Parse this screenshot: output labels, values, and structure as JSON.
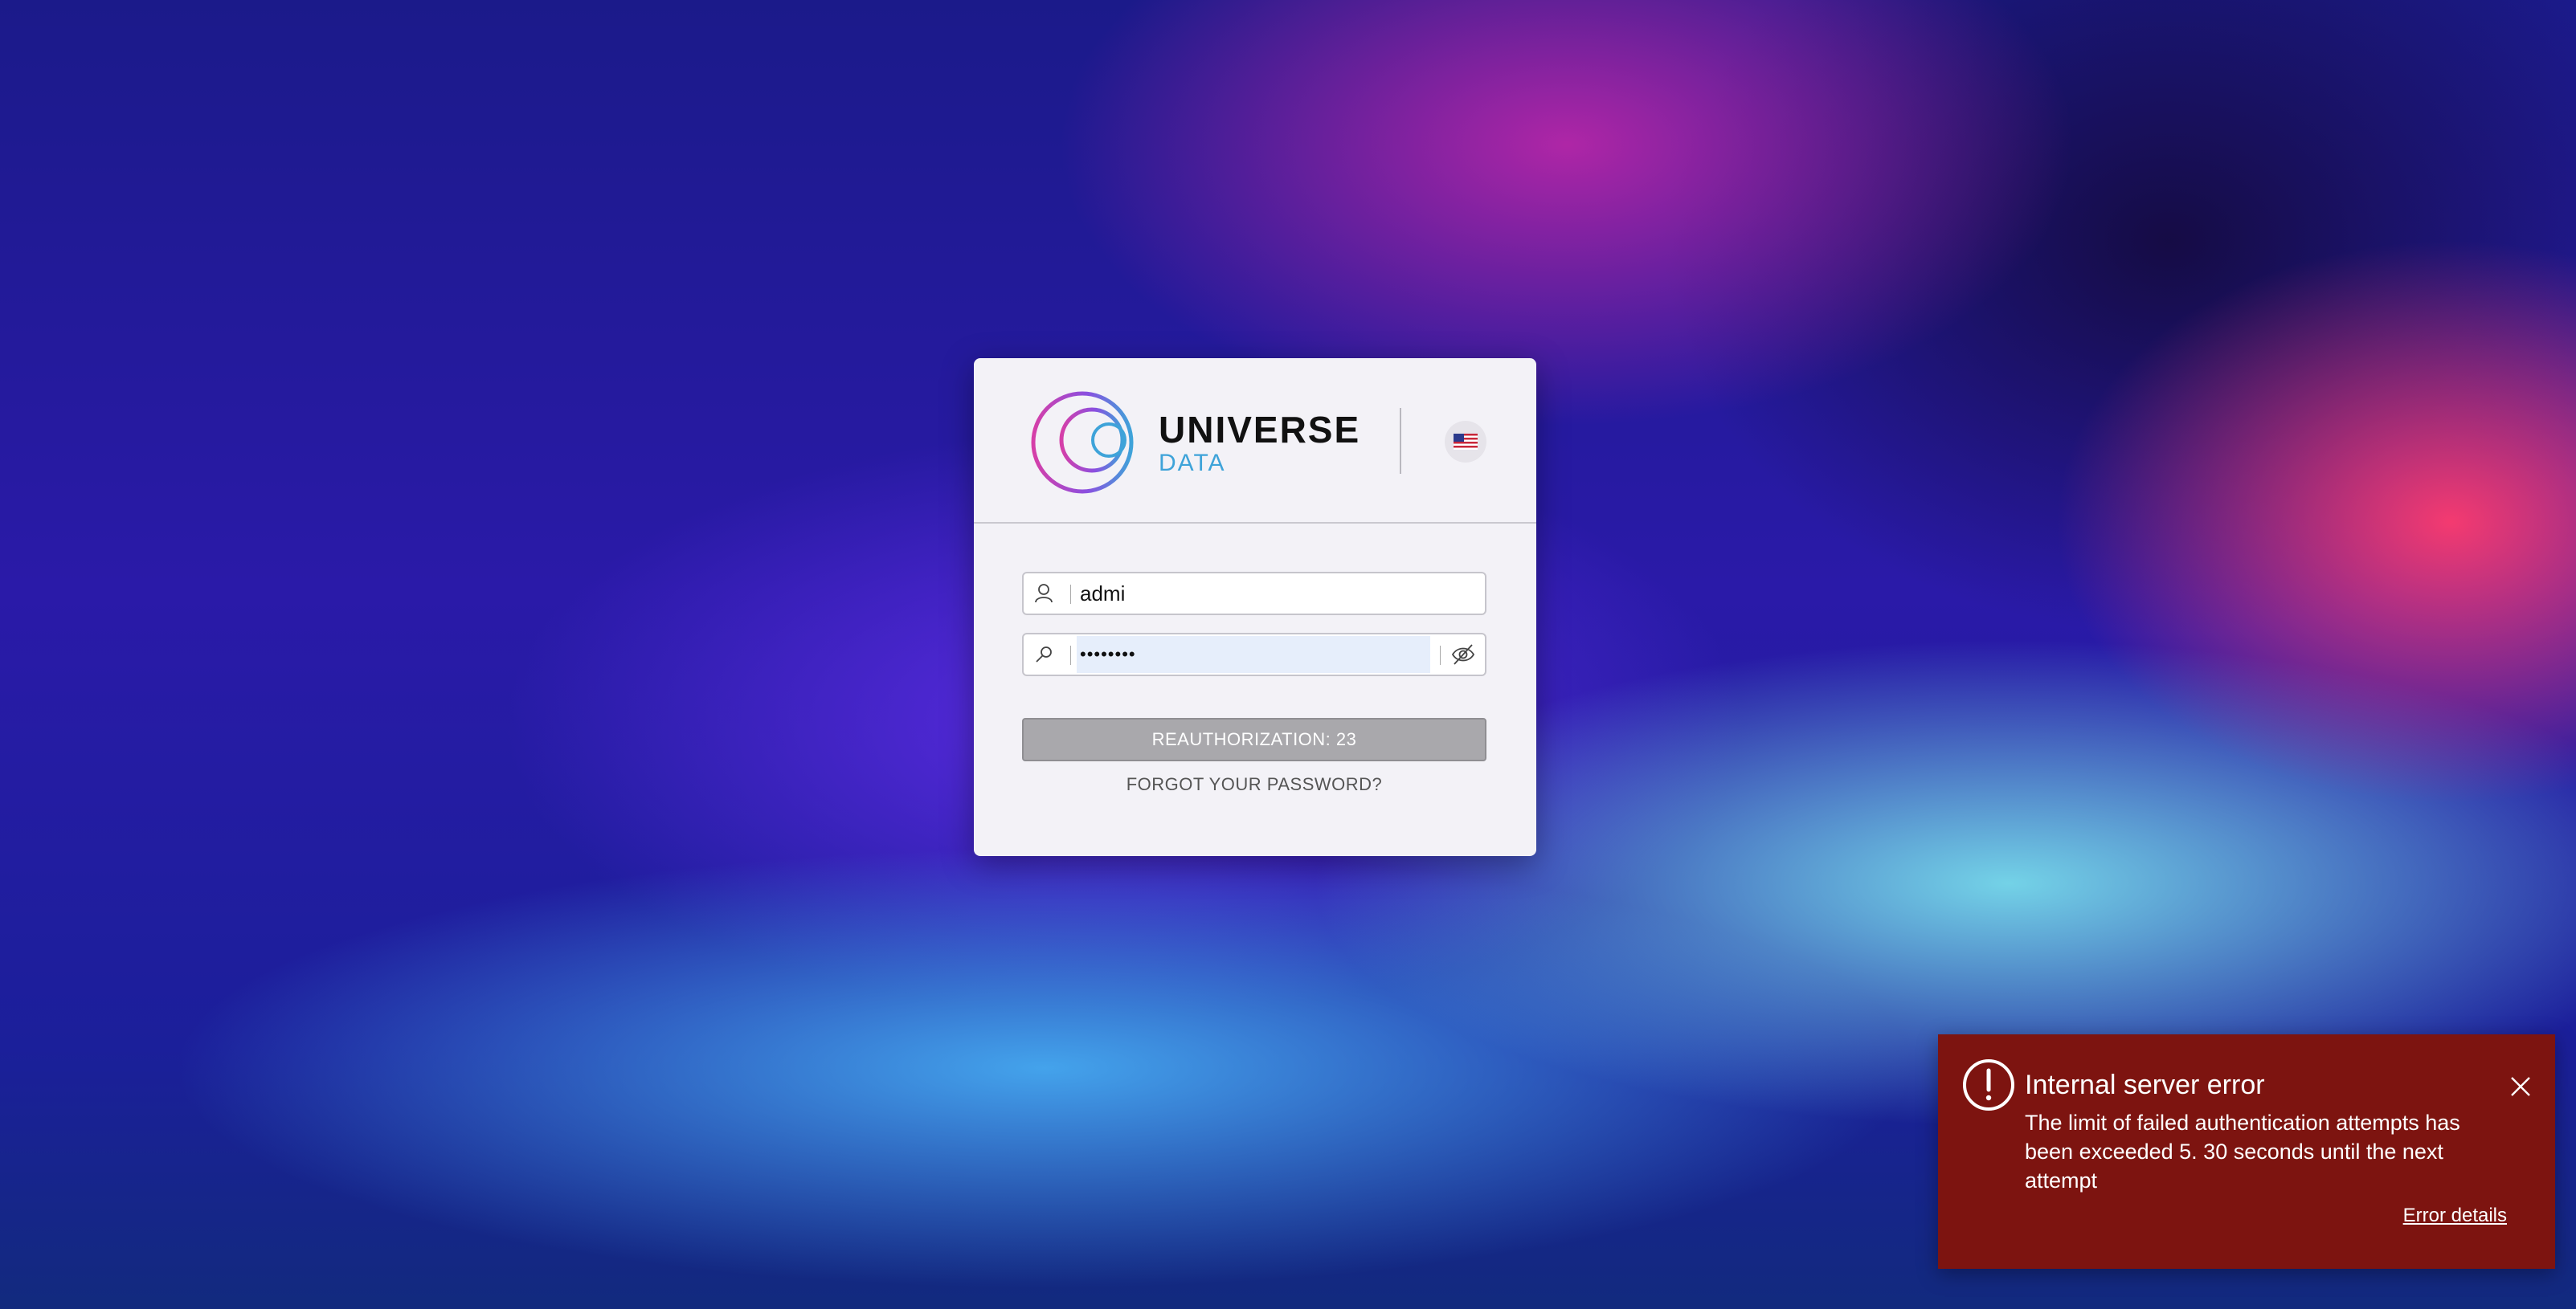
{
  "brand": {
    "name": "UNIVERSE",
    "sub": "DATA",
    "accent_color": "#3ea3d9"
  },
  "language": {
    "current": "en-US",
    "icon": "us-flag-icon"
  },
  "login_form": {
    "username": {
      "value": "admi",
      "icon": "user-icon"
    },
    "password": {
      "masked_value": "••••••••",
      "icon": "key-icon",
      "toggle_icon": "eye-off-icon"
    },
    "submit_label": "REAUTHORIZATION: 23",
    "forgot_label": "FORGOT YOUR PASSWORD?"
  },
  "toast": {
    "title": "Internal server error",
    "message": "The limit of failed authentication attempts has been exceeded 5. 30 seconds until the next attempt",
    "details_link": "Error details",
    "background_color": "#7d1410"
  }
}
